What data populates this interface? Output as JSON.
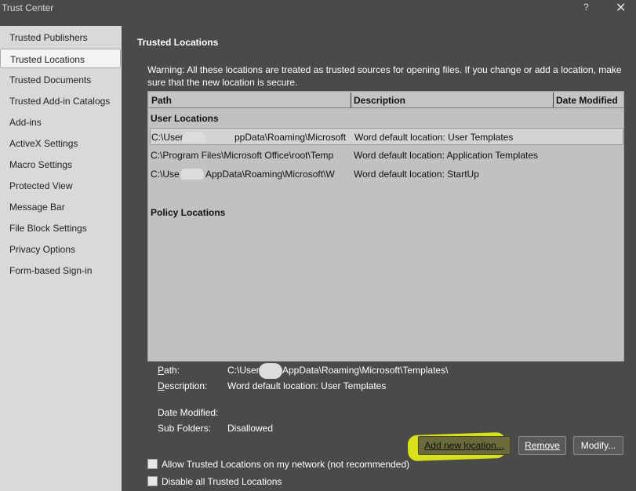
{
  "window": {
    "title": "Trust Center",
    "help_label": "?",
    "close_label": "✕"
  },
  "sidebar": {
    "items": [
      {
        "label": "Trusted Publishers",
        "selected": false
      },
      {
        "label": "Trusted Locations",
        "selected": true
      },
      {
        "label": "Trusted Documents",
        "selected": false
      },
      {
        "label": "Trusted Add-in Catalogs",
        "selected": false
      },
      {
        "label": "Add-ins",
        "selected": false
      },
      {
        "label": "ActiveX Settings",
        "selected": false
      },
      {
        "label": "Macro Settings",
        "selected": false
      },
      {
        "label": "Protected View",
        "selected": false
      },
      {
        "label": "Message Bar",
        "selected": false
      },
      {
        "label": "File Block Settings",
        "selected": false
      },
      {
        "label": "Privacy Options",
        "selected": false
      },
      {
        "label": "Form-based Sign-in",
        "selected": false
      }
    ]
  },
  "main": {
    "section_title": "Trusted Locations",
    "warning": "Warning: All these locations are treated as trusted sources for opening files.  If you change or add a location, make sure that the new location is secure.",
    "columns": [
      "Path",
      "Description",
      "Date Modified"
    ],
    "user_group_label": "User Locations",
    "policy_group_label": "Policy Locations",
    "rows": [
      {
        "path_start": "C:\\User",
        "path_end": "ppData\\Roaming\\Microsoft\\Te",
        "description": "Word default location: User Templates",
        "selected": true
      },
      {
        "path_start": "C:\\Program Files\\Microsoft Office\\root\\Temp",
        "path_end": "",
        "description": "Word default location: Application Templates",
        "selected": false
      },
      {
        "path_start": "C:\\Use",
        "path_end": "AppData\\Roaming\\Microsoft\\W",
        "description": "Word default location: StartUp",
        "selected": false
      }
    ],
    "details": {
      "path_label": "Path:",
      "path_start": "C:\\User",
      "path_end": "AppData\\Roaming\\Microsoft\\Templates\\",
      "description_label": "Description:",
      "description_value": "Word default location: User Templates",
      "date_modified_label": "Date Modified:",
      "date_modified_value": "",
      "sub_folders_label": "Sub Folders:",
      "sub_folders_value": "Disallowed"
    },
    "buttons": {
      "add": "Add new location...",
      "remove": "Remove",
      "modify": "Modify..."
    },
    "checkboxes": [
      {
        "label": "Allow Trusted Locations on my network (not recommended)",
        "checked": false
      },
      {
        "label": "Disable all Trusted Locations",
        "checked": false
      }
    ]
  },
  "colors": {
    "background": "#4a4a4a",
    "sidebar": "#d9d9d9",
    "list": "#c1c1c1",
    "highlight": "#d8e01a"
  }
}
